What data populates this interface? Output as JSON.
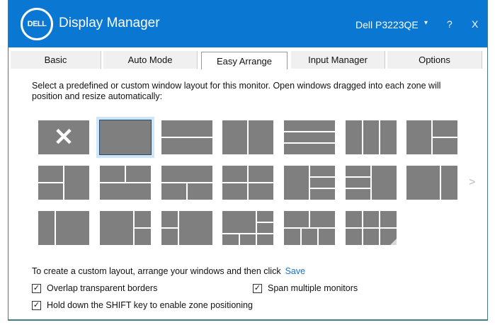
{
  "titlebar": {
    "logo": "DELL",
    "title": "Display Manager",
    "monitor": "Dell P3223QE",
    "caret": "▾",
    "help": "?",
    "close": "X"
  },
  "tabs": [
    {
      "label": "Basic"
    },
    {
      "label": "Auto Mode"
    },
    {
      "label": "Easy Arrange",
      "active": true
    },
    {
      "label": "Input Manager"
    },
    {
      "label": "Options"
    }
  ],
  "description": "Select a predefined or custom window layout for this monitor.  Open windows dragged into each zone will position and resize automatically:",
  "layouts": {
    "selected_index": 1,
    "next_label": ">",
    "none_glyph": "✕"
  },
  "custom": {
    "text": "To create a custom layout, arrange your windows and then click",
    "save": "Save"
  },
  "options": [
    {
      "label": "Overlap transparent borders",
      "checked": true
    },
    {
      "label": "Span multiple monitors",
      "checked": true
    },
    {
      "label": "Hold down the SHIFT key to enable zone positioning",
      "checked": true
    }
  ],
  "check_glyph": "✓"
}
